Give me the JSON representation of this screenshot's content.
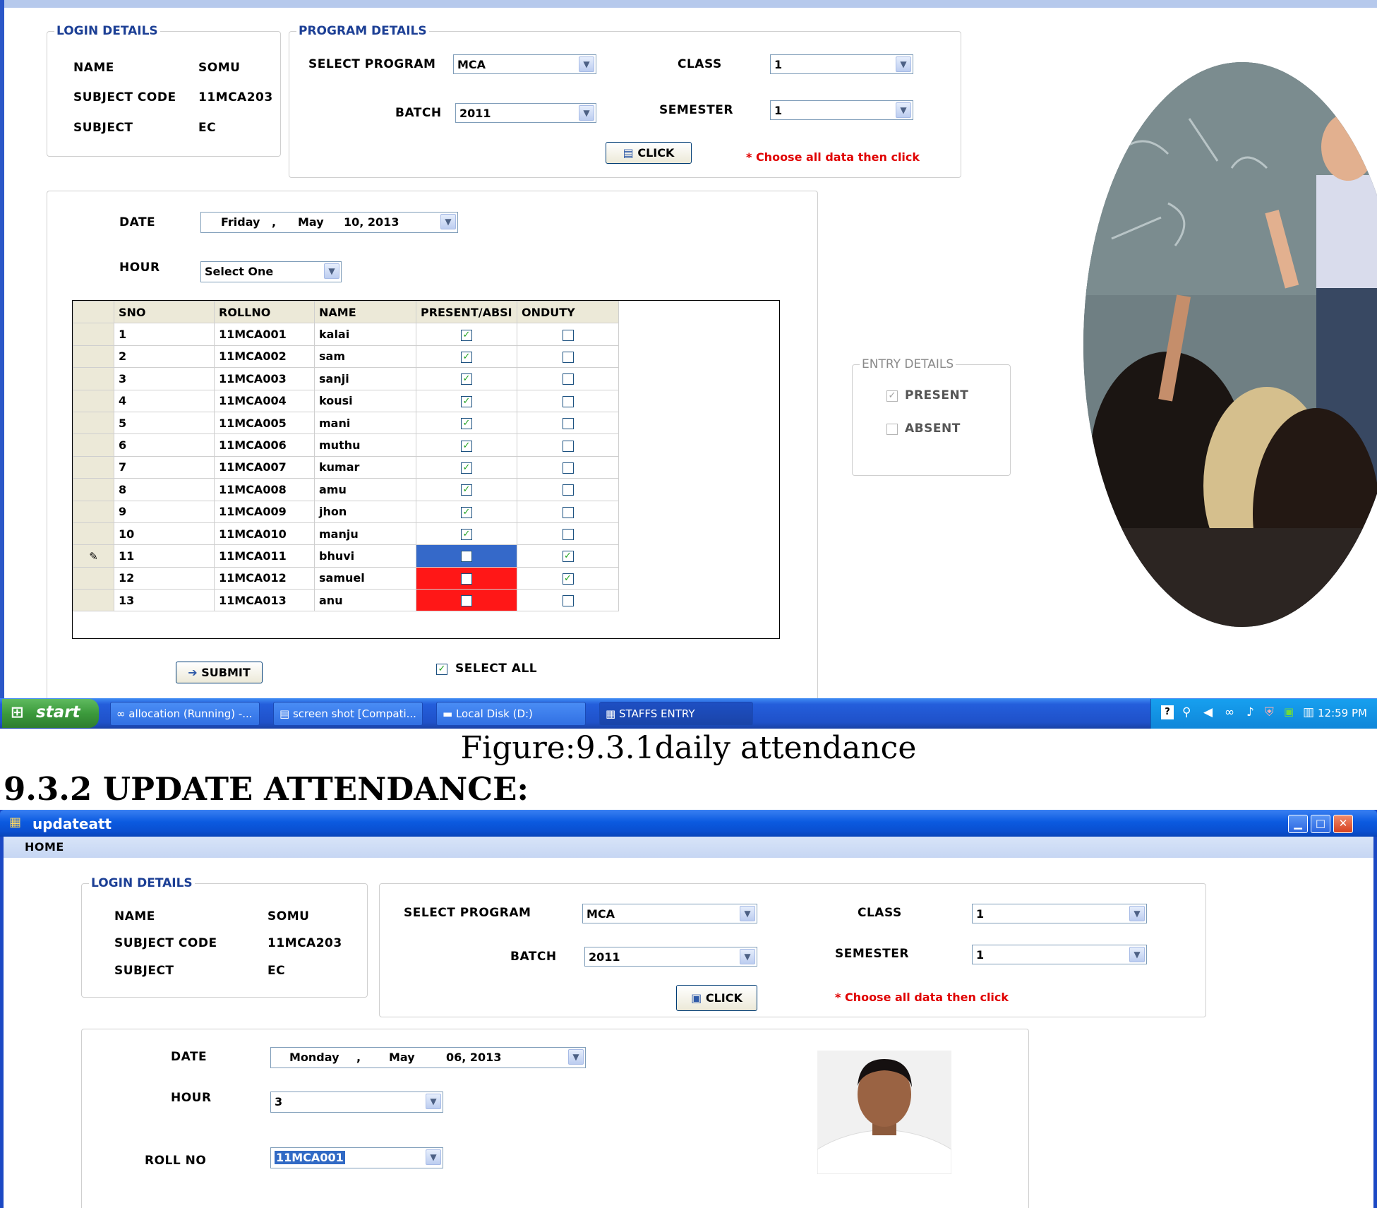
{
  "screen1": {
    "login": {
      "title": "LOGIN DETAILS",
      "name_label": "NAME",
      "name_value": "SOMU",
      "code_label": "SUBJECT CODE",
      "code_value": "11MCA203",
      "subject_label": "SUBJECT",
      "subject_value": "EC"
    },
    "program": {
      "title": "PROGRAM DETAILS",
      "program_label": "SELECT PROGRAM",
      "program_value": "MCA",
      "class_label": "CLASS",
      "class_value": "1",
      "batch_label": "BATCH",
      "batch_value": "2011",
      "semester_label": "SEMESTER",
      "semester_value": "1",
      "click_label": "CLICK",
      "hint": "* Choose all data then click"
    },
    "attendance": {
      "date_label": "DATE",
      "date_day": "Friday",
      "date_sep": ",",
      "date_month": "May",
      "date_rest": "10, 2013",
      "hour_label": "HOUR",
      "hour_value": "Select One",
      "columns": [
        "SNO",
        "ROLLNO",
        "NAME",
        "PRESENT/ABSI",
        "ONDUTY"
      ],
      "rows": [
        {
          "sno": "1",
          "roll": "11MCA001",
          "name": "kalai",
          "present": true,
          "onduty": false,
          "status": "normal"
        },
        {
          "sno": "2",
          "roll": "11MCA002",
          "name": "sam",
          "present": true,
          "onduty": false,
          "status": "normal"
        },
        {
          "sno": "3",
          "roll": "11MCA003",
          "name": "sanji",
          "present": true,
          "onduty": false,
          "status": "normal"
        },
        {
          "sno": "4",
          "roll": "11MCA004",
          "name": "kousi",
          "present": true,
          "onduty": false,
          "status": "normal"
        },
        {
          "sno": "5",
          "roll": "11MCA005",
          "name": "mani",
          "present": true,
          "onduty": false,
          "status": "normal"
        },
        {
          "sno": "6",
          "roll": "11MCA006",
          "name": "muthu",
          "present": true,
          "onduty": false,
          "status": "normal"
        },
        {
          "sno": "7",
          "roll": "11MCA007",
          "name": "kumar",
          "present": true,
          "onduty": false,
          "status": "normal"
        },
        {
          "sno": "8",
          "roll": "11MCA008",
          "name": "amu",
          "present": true,
          "onduty": false,
          "status": "normal"
        },
        {
          "sno": "9",
          "roll": "11MCA009",
          "name": "jhon",
          "present": true,
          "onduty": false,
          "status": "normal"
        },
        {
          "sno": "10",
          "roll": "11MCA010",
          "name": "manju",
          "present": true,
          "onduty": false,
          "status": "normal"
        },
        {
          "sno": "11",
          "roll": "11MCA011",
          "name": "bhuvi",
          "present": false,
          "onduty": true,
          "status": "selected"
        },
        {
          "sno": "12",
          "roll": "11MCA012",
          "name": "samuel",
          "present": false,
          "onduty": true,
          "status": "absent"
        },
        {
          "sno": "13",
          "roll": "11MCA013",
          "name": "anu",
          "present": false,
          "onduty": false,
          "status": "absent"
        }
      ],
      "submit_label": "SUBMIT",
      "select_all_label": "SELECT ALL"
    },
    "entry": {
      "title": "ENTRY DETAILS",
      "present_label": "PRESENT",
      "absent_label": "ABSENT"
    },
    "taskbar": {
      "start_label": "start",
      "tasks": [
        "allocation (Running) -...",
        "screen shot [Compati...",
        "Local Disk (D:)",
        "STAFFS ENTRY"
      ],
      "clock": "12:59 PM"
    }
  },
  "caption": "Figure:9.3.1daily attendance",
  "heading": "9.3.2 UPDATE ATTENDANCE:",
  "screen2": {
    "window_title": "updateatt",
    "menu_home": "HOME",
    "login": {
      "title": "LOGIN DETAILS",
      "name_label": "NAME",
      "name_value": "SOMU",
      "code_label": "SUBJECT CODE",
      "code_value": "11MCA203",
      "subject_label": "SUBJECT",
      "subject_value": "EC"
    },
    "program": {
      "program_label": "SELECT PROGRAM",
      "program_value": "MCA",
      "class_label": "CLASS",
      "class_value": "1",
      "batch_label": "BATCH",
      "batch_value": "2011",
      "semester_label": "SEMESTER",
      "semester_value": "1",
      "click_label": "CLICK",
      "hint": "* Choose all data then click"
    },
    "attendance": {
      "date_label": "DATE",
      "date_day": "Monday",
      "date_sep": ",",
      "date_month": "May",
      "date_rest": "06, 2013",
      "hour_label": "HOUR",
      "hour_value": "3",
      "roll_label": "ROLL NO",
      "roll_value": "11MCA001"
    }
  },
  "colors": {
    "accent": "#1c3f95",
    "hint": "#e00000",
    "absent_cell": "#ff1717",
    "selected_cell": "#3569c9",
    "titlebar": "#0a4fd0"
  }
}
